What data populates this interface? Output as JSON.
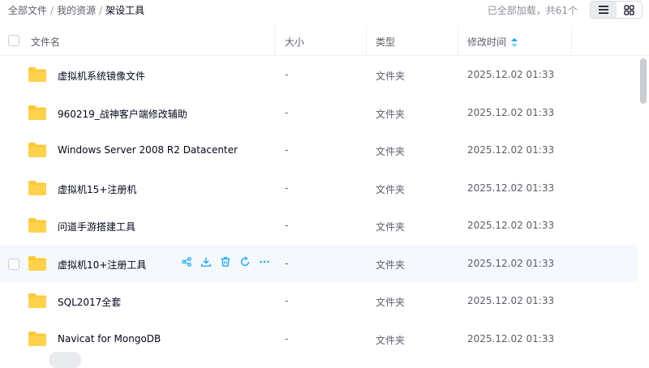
{
  "breadcrumb": {
    "items": [
      "全部文件",
      "我的资源",
      "架设工具"
    ],
    "separator": "/"
  },
  "status": {
    "loaded_text": "已全部加载，共61个"
  },
  "view_switch": {
    "active": "list-view-icon",
    "other": "grid-view-icon"
  },
  "header": {
    "name": "文件名",
    "size": "大小",
    "type": "类型",
    "mtime": "修改时间"
  },
  "files": [
    {
      "name": "虚拟机系统镜像文件",
      "size": "-",
      "type": "文件夹",
      "time": "2025.12.02 01:33"
    },
    {
      "name": "960219_战神客户端修改辅助",
      "size": "-",
      "type": "文件夹",
      "time": "2025.12.02 01:33"
    },
    {
      "name": "Windows Server 2008 R2 Datacenter",
      "size": "-",
      "type": "文件夹",
      "time": "2025.12.02 01:33"
    },
    {
      "name": "虚拟机15+注册机",
      "size": "-",
      "type": "文件夹",
      "time": "2025.12.02 01:33"
    },
    {
      "name": "问道手游搭建工具",
      "size": "-",
      "type": "文件夹",
      "time": "2025.12.02 01:33"
    },
    {
      "name": "虚拟机10+注册工具",
      "size": "-",
      "type": "文件夹",
      "time": "2025.12.02 01:33"
    },
    {
      "name": "SQL2017全套",
      "size": "-",
      "type": "文件夹",
      "time": "2025.12.02 01:33"
    },
    {
      "name": "Navicat for MongoDB",
      "size": "-",
      "type": "文件夹",
      "time": "2025.12.02 01:33"
    }
  ],
  "row_actions": [
    "share-icon",
    "download-icon",
    "delete-icon",
    "sync-icon",
    "more-icon"
  ],
  "colors": {
    "accent": "#06a7ff",
    "folder": "#ffc935",
    "hover_row": "#f5f8fd"
  }
}
